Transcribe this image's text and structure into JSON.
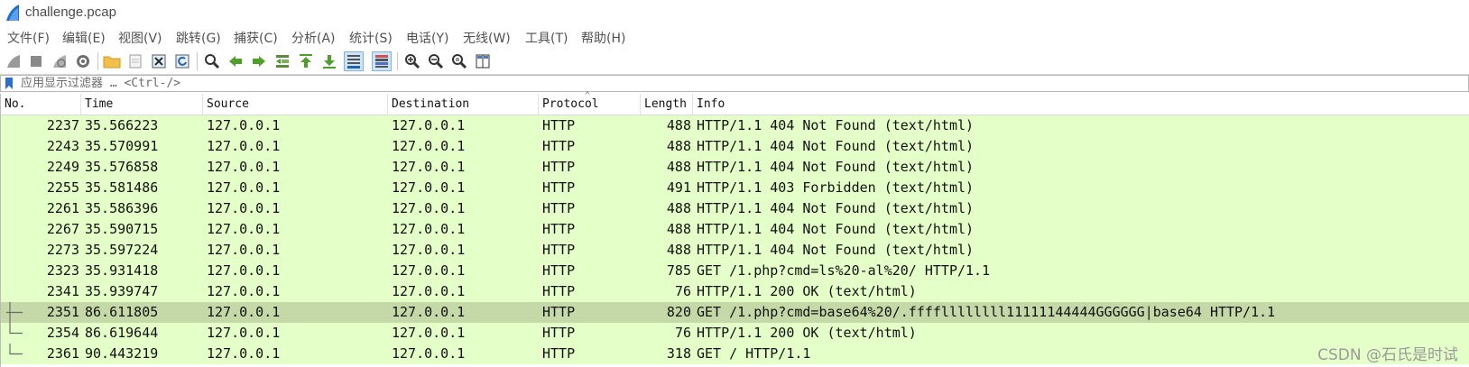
{
  "window": {
    "title": "challenge.pcap"
  },
  "menu": [
    "文件(F)",
    "编辑(E)",
    "视图(V)",
    "跳转(G)",
    "捕获(C)",
    "分析(A)",
    "统计(S)",
    "电话(Y)",
    "无线(W)",
    "工具(T)",
    "帮助(H)"
  ],
  "toolbar": {
    "buttons": [
      "start-capture",
      "stop-capture",
      "restart-capture",
      "capture-options",
      "open-file",
      "save-file",
      "close-file",
      "reload-file",
      "find-packet",
      "go-back",
      "go-forward",
      "go-to-packet",
      "first-packet",
      "last-packet",
      "auto-scroll",
      "colorize",
      "zoom-in",
      "zoom-out",
      "normal-size",
      "resize-columns"
    ]
  },
  "filter": {
    "placeholder": "应用显示过滤器 … <Ctrl-/>"
  },
  "columns": [
    "No.",
    "Time",
    "Source",
    "Destination",
    "Protocol",
    "Length",
    "Info"
  ],
  "colors": {
    "http_row": "#e4ffc7",
    "selected_row": "#c5d9a8"
  },
  "rows": [
    {
      "no": "2237",
      "time": "35.566223",
      "src": "127.0.0.1",
      "dst": "127.0.0.1",
      "proto": "HTTP",
      "len": "488",
      "info": "HTTP/1.1 404 Not Found  (text/html)"
    },
    {
      "no": "2243",
      "time": "35.570991",
      "src": "127.0.0.1",
      "dst": "127.0.0.1",
      "proto": "HTTP",
      "len": "488",
      "info": "HTTP/1.1 404 Not Found  (text/html)"
    },
    {
      "no": "2249",
      "time": "35.576858",
      "src": "127.0.0.1",
      "dst": "127.0.0.1",
      "proto": "HTTP",
      "len": "488",
      "info": "HTTP/1.1 404 Not Found  (text/html)"
    },
    {
      "no": "2255",
      "time": "35.581486",
      "src": "127.0.0.1",
      "dst": "127.0.0.1",
      "proto": "HTTP",
      "len": "491",
      "info": "HTTP/1.1 403 Forbidden  (text/html)"
    },
    {
      "no": "2261",
      "time": "35.586396",
      "src": "127.0.0.1",
      "dst": "127.0.0.1",
      "proto": "HTTP",
      "len": "488",
      "info": "HTTP/1.1 404 Not Found  (text/html)"
    },
    {
      "no": "2267",
      "time": "35.590715",
      "src": "127.0.0.1",
      "dst": "127.0.0.1",
      "proto": "HTTP",
      "len": "488",
      "info": "HTTP/1.1 404 Not Found  (text/html)"
    },
    {
      "no": "2273",
      "time": "35.597224",
      "src": "127.0.0.1",
      "dst": "127.0.0.1",
      "proto": "HTTP",
      "len": "488",
      "info": "HTTP/1.1 404 Not Found  (text/html)"
    },
    {
      "no": "2323",
      "time": "35.931418",
      "src": "127.0.0.1",
      "dst": "127.0.0.1",
      "proto": "HTTP",
      "len": "785",
      "info": "GET /1.php?cmd=ls%20-al%20/ HTTP/1.1"
    },
    {
      "no": "2341",
      "time": "35.939747",
      "src": "127.0.0.1",
      "dst": "127.0.0.1",
      "proto": "HTTP",
      "len": "76",
      "info": "HTTP/1.1 200 OK  (text/html)"
    },
    {
      "no": "2351",
      "time": "86.611805",
      "src": "127.0.0.1",
      "dst": "127.0.0.1",
      "proto": "HTTP",
      "len": "820",
      "info": "GET /1.php?cmd=base64%20/.ffffllllllll11111144444GGGGGG|base64 HTTP/1.1",
      "selected": true
    },
    {
      "no": "2354",
      "time": "86.619644",
      "src": "127.0.0.1",
      "dst": "127.0.0.1",
      "proto": "HTTP",
      "len": "76",
      "info": "HTTP/1.1 200 OK  (text/html)"
    },
    {
      "no": "2361",
      "time": "90.443219",
      "src": "127.0.0.1",
      "dst": "127.0.0.1",
      "proto": "HTTP",
      "len": "318",
      "info": "GET / HTTP/1.1"
    }
  ],
  "watermark": "CSDN @石氏是时试"
}
